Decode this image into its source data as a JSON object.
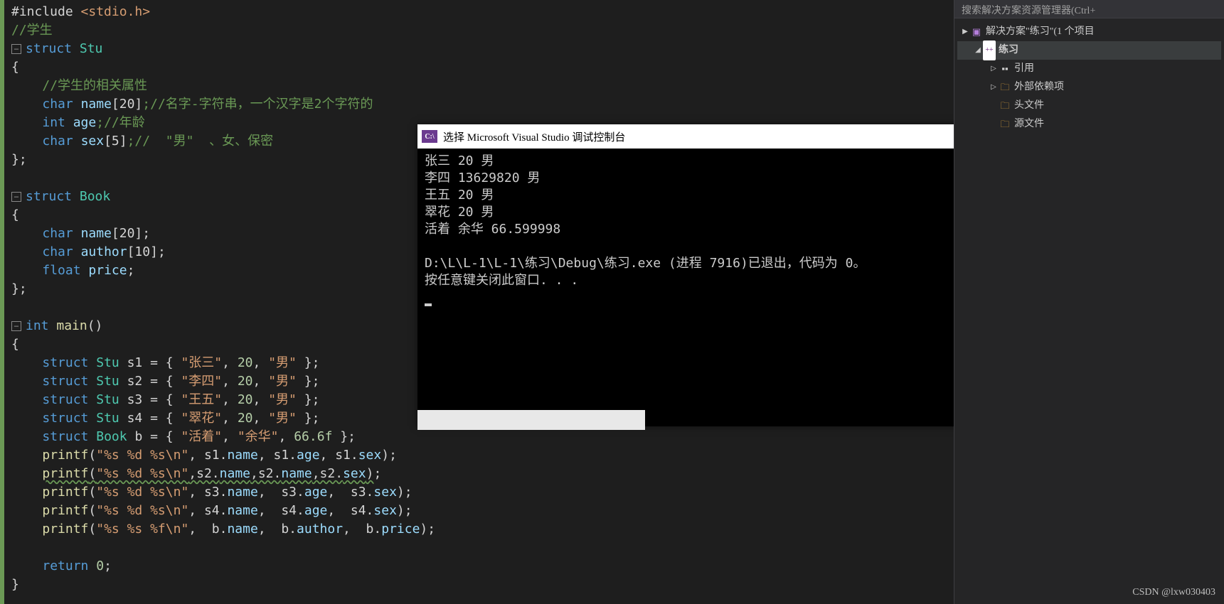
{
  "code": {
    "l1_include": "#include",
    "l1_hdr": "<stdio.h>",
    "l2_cmt": "//学生",
    "l3_struct": "struct",
    "l3_name": "Stu",
    "l4": "{",
    "l5_cmt": "//学生的相关属性",
    "l6_type": "char",
    "l6_var": "name",
    "l6_arr": "[20]",
    "l6_cmt": ";//名字-字符串，一个汉字是2个字符的",
    "l7_type": "int",
    "l7_var": "age",
    "l7_cmt": ";//年龄",
    "l8_type": "char",
    "l8_var": "sex",
    "l8_arr": "[5]",
    "l8_cmt": ";//  \"男\"  、女、保密",
    "l9": "};",
    "l11_struct": "struct",
    "l11_name": "Book",
    "l12": "{",
    "l13_type": "char",
    "l13_var": "name",
    "l13_arr": "[20];",
    "l14_type": "char",
    "l14_var": "author",
    "l14_arr": "[10];",
    "l15_type": "float",
    "l15_var": "price",
    "l15_end": ";",
    "l16": "};",
    "l18_type": "int",
    "l18_main": "main",
    "l18_p": "()",
    "l19": "{",
    "l20_struct": "struct",
    "l20_type": "Stu",
    "l20_var": "s1",
    "l20_eq": " = { ",
    "l20_s1": "\"张三\"",
    "l20_c": ", ",
    "l20_n": "20",
    "l20_s2": "\"男\"",
    "l20_end": " };",
    "l21_var": "s2",
    "l21_s1": "\"李四\"",
    "l22_var": "s3",
    "l22_s1": "\"王五\"",
    "l23_var": "s4",
    "l23_s1": "\"翠花\"",
    "l24_type": "Book",
    "l24_var": "b",
    "l24_s1": "\"活着\"",
    "l24_s2": "\"余华\"",
    "l24_n": "66.6f",
    "l25_fn": "printf",
    "l25_s": "\"%s %d %s\\n\"",
    "l25_a": ", s1.",
    "l25_n1": "name",
    "l25_c2": ", s1.",
    "l25_n2": "age",
    "l25_c3": ", s1.",
    "l25_n3": "sex",
    "l25_end": ");",
    "l26_a": ",s2.",
    "l26_n1": "name",
    "l26_c2": ",s2.",
    "l26_n2": "name",
    "l26_c3": ",s2.",
    "l26_n3": "sex",
    "l27_a": ", s3.",
    "l27_n1": "name",
    "l27_c2": ",  s3.",
    "l27_n2": "age",
    "l27_c3": ",  s3.",
    "l27_n3": "sex",
    "l28_a": ", s4.",
    "l28_n1": "name",
    "l28_c2": ",  s4.",
    "l28_n2": "age",
    "l28_c3": ",  s4.",
    "l28_n3": "sex",
    "l29_s": "\"%s %s %f\\n\"",
    "l29_a": ",  b.",
    "l29_n1": "name",
    "l29_c2": ",  b.",
    "l29_n2": "author",
    "l29_c3": ",  b.",
    "l29_n3": "price",
    "l31_ret": "return",
    "l31_n": "0",
    "l31_end": ";",
    "l32": "}"
  },
  "console": {
    "title": "选择 Microsoft Visual Studio 调试控制台",
    "icon": "C:\\",
    "out1": "张三 20 男",
    "out2": "李四 13629820 男",
    "out3": "王五 20 男",
    "out4": "翠花 20 男",
    "out5": "活着 余华 66.599998",
    "out6": "",
    "out7": "D:\\L\\L-1\\L-1\\练习\\Debug\\练习.exe (进程 7916)已退出，代码为 0。",
    "out8": "按任意键关闭此窗口. . ."
  },
  "solution": {
    "search": "搜索解决方案资源管理器(Ctrl+",
    "root": "解决方案\"练习\"(1 个项目",
    "project": "练习",
    "refs": "引用",
    "ext": "外部依赖项",
    "headers": "头文件",
    "src": "源文件"
  },
  "watermark": "CSDN @lxw030403"
}
